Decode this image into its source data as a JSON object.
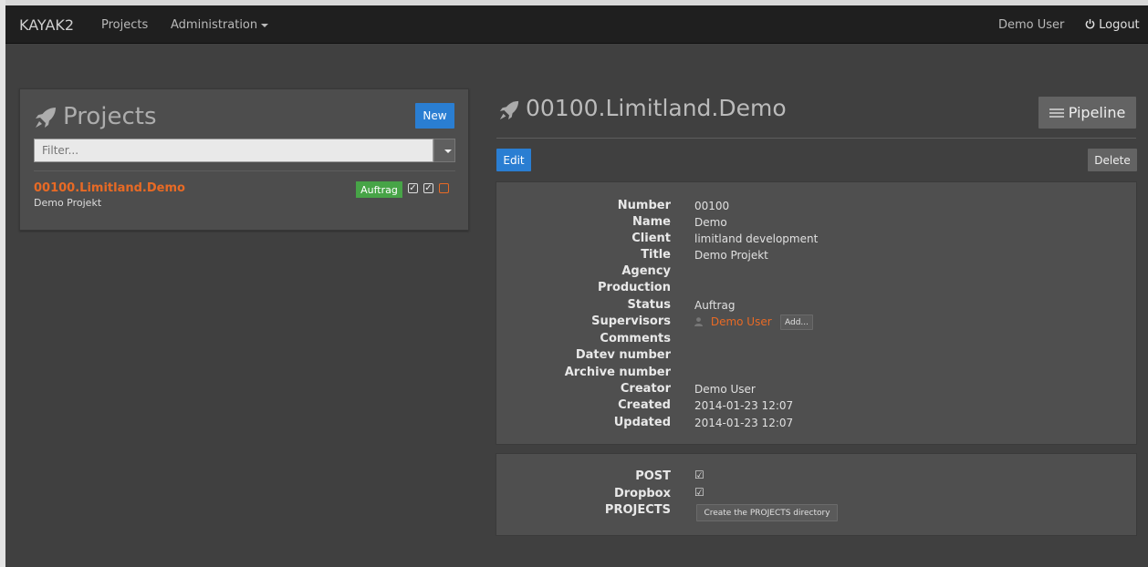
{
  "navbar": {
    "brand": "KAYAK2",
    "projects": "Projects",
    "administration": "Administration",
    "user": "Demo User",
    "logout": "Logout"
  },
  "projects_panel": {
    "title": "Projects",
    "new_label": "New",
    "filter_placeholder": "Filter...",
    "items": [
      {
        "name": "00100.Limitland.Demo",
        "subtitle": "Demo Projekt",
        "status": "Auftrag",
        "flags": [
          true,
          true,
          false
        ]
      }
    ]
  },
  "detail": {
    "title": "00100.Limitland.Demo",
    "pipeline_label": "Pipeline",
    "edit_label": "Edit",
    "delete_label": "Delete",
    "fields": [
      {
        "label": "Number",
        "value": "00100"
      },
      {
        "label": "Name",
        "value": "Demo"
      },
      {
        "label": "Client",
        "value": "limitland development"
      },
      {
        "label": "Title",
        "value": "Demo Projekt"
      },
      {
        "label": "Agency",
        "value": ""
      },
      {
        "label": "Production",
        "value": ""
      },
      {
        "label": "Status",
        "value": "Auftrag"
      },
      {
        "label": "Supervisors",
        "value": "Demo User"
      },
      {
        "label": "Comments",
        "value": ""
      },
      {
        "label": "Datev number",
        "value": ""
      },
      {
        "label": "Archive number",
        "value": ""
      },
      {
        "label": "Creator",
        "value": "Demo User"
      },
      {
        "label": "Created",
        "value": "2014-01-23 12:07"
      },
      {
        "label": "Updated",
        "value": "2014-01-23 12:07"
      }
    ],
    "add_supervisor_label": "Add...",
    "flags": [
      {
        "label": "POST",
        "checked": true
      },
      {
        "label": "Dropbox",
        "checked": true
      },
      {
        "label": "PROJECTS",
        "button": "Create the PROJECTS directory"
      }
    ]
  },
  "colors": {
    "accent_orange": "#e86a25",
    "primary_blue": "#2a7ed2",
    "success_green": "#47a447"
  }
}
